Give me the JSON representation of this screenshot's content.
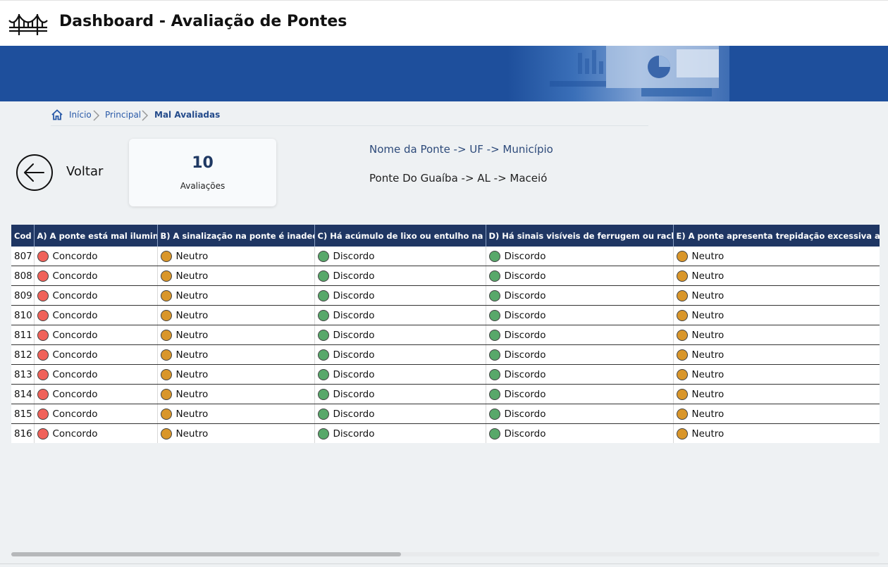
{
  "app": {
    "title": "Dashboard - Avaliação de Pontes"
  },
  "icons": {
    "logo": "bridge-icon",
    "home": "home-icon",
    "separator": "chevron-right-icon",
    "back": "arrow-left-circle-icon"
  },
  "breadcrumb": [
    {
      "label": "Início",
      "current": false
    },
    {
      "label": "Principal",
      "current": false
    },
    {
      "label": "Mal Avaliadas",
      "current": true
    }
  ],
  "back": {
    "label": "Voltar"
  },
  "card": {
    "value": "10",
    "label": "Avaliações"
  },
  "info": {
    "header": "Nome da Ponte -> UF -> Município",
    "value": "Ponte Do Guaíba -> AL -> Maceió"
  },
  "colors": {
    "Concordo": "#f0625a",
    "Neutro": "#d9962a",
    "Discordo": "#58a86a",
    "header_bg": "#1f3663",
    "banner": "#1e4f9c"
  },
  "table": {
    "columns": [
      "Cod",
      "A) A ponte está mal iluminada?",
      "B) A sinalização na ponte é inadequada?",
      "C) Há acúmulo de lixo ou entulho na ponte?",
      "D) Há sinais visíveis de ferrugem ou rachaduras?",
      "E) A ponte apresenta trepidação excessiva ao passar veículos?"
    ],
    "rows": [
      [
        "807",
        "Concordo",
        "Neutro",
        "Discordo",
        "Discordo",
        "Neutro"
      ],
      [
        "808",
        "Concordo",
        "Neutro",
        "Discordo",
        "Discordo",
        "Neutro"
      ],
      [
        "809",
        "Concordo",
        "Neutro",
        "Discordo",
        "Discordo",
        "Neutro"
      ],
      [
        "810",
        "Concordo",
        "Neutro",
        "Discordo",
        "Discordo",
        "Neutro"
      ],
      [
        "811",
        "Concordo",
        "Neutro",
        "Discordo",
        "Discordo",
        "Neutro"
      ],
      [
        "812",
        "Concordo",
        "Neutro",
        "Discordo",
        "Discordo",
        "Neutro"
      ],
      [
        "813",
        "Concordo",
        "Neutro",
        "Discordo",
        "Discordo",
        "Neutro"
      ],
      [
        "814",
        "Concordo",
        "Neutro",
        "Discordo",
        "Discordo",
        "Neutro"
      ],
      [
        "815",
        "Concordo",
        "Neutro",
        "Discordo",
        "Discordo",
        "Neutro"
      ],
      [
        "816",
        "Concordo",
        "Neutro",
        "Discordo",
        "Discordo",
        "Neutro"
      ]
    ]
  }
}
